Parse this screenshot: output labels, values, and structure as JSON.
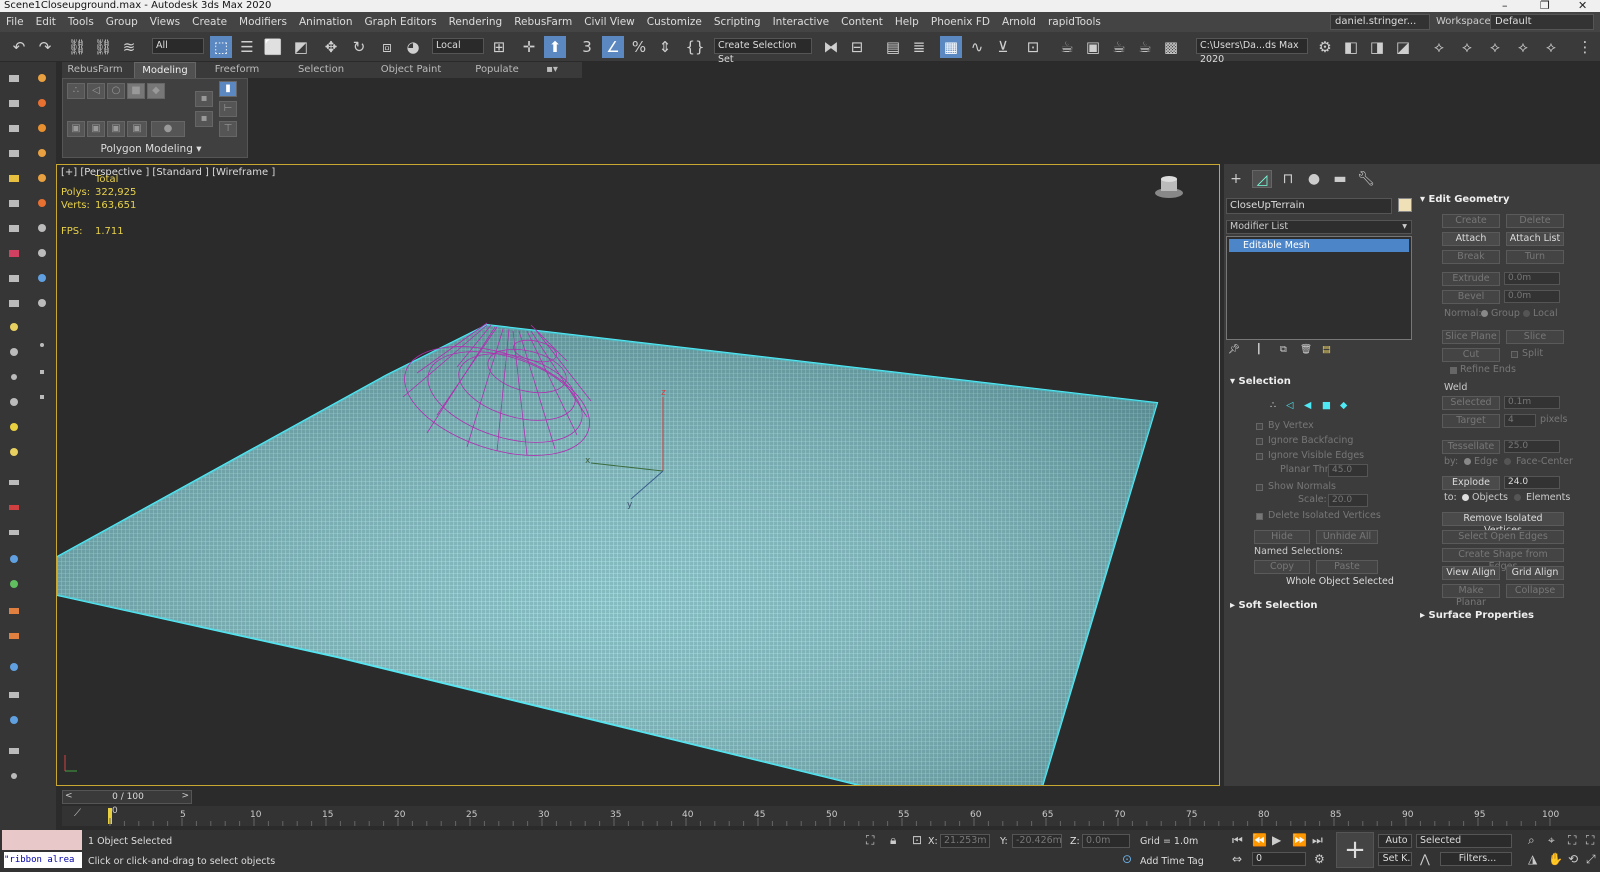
{
  "app": {
    "title": "Scene1Closeupground.max - Autodesk 3ds Max 2020",
    "win_min": "–",
    "win_max": "❐",
    "win_close": "✕"
  },
  "menu": [
    "File",
    "Edit",
    "Tools",
    "Group",
    "Views",
    "Create",
    "Modifiers",
    "Animation",
    "Graph Editors",
    "Rendering",
    "RebusFarm",
    "Civil View",
    "Customize",
    "Scripting",
    "Interactive",
    "Content",
    "Help",
    "Phoenix FD",
    "Arnold",
    "rapidTools"
  ],
  "user": "daniel.stringer...",
  "workspace": {
    "label": "Workspaces:",
    "value": "Default"
  },
  "toolbar": {
    "filter": "All",
    "coord": "Local",
    "selection_set": "Create Selection Set",
    "path": "C:\\Users\\Da...ds Max 2020"
  },
  "ribbon": {
    "tabs": [
      "RebusFarm",
      "Modeling",
      "Freeform",
      "Selection",
      "Object Paint",
      "Populate"
    ],
    "active_tab": "Modeling",
    "panel_label": "Polygon Modeling"
  },
  "viewport": {
    "label": "[+] [Perspective ] [Standard ] [Wireframe ]",
    "stats_total": "Total",
    "polys_label": "Polys:",
    "polys": "322,925",
    "verts_label": "Verts:",
    "verts": "163,651",
    "fps_label": "FPS:",
    "fps": "1.711",
    "axis_z": "z",
    "axis_x": "x",
    "axis_y": "y",
    "colors": {
      "terrain": "#8ee8ee",
      "terrain_edge": "#4fe9f5",
      "cone": "#b030b0"
    }
  },
  "command_panel": {
    "object_name": "CloseUpTerrain",
    "modifier_list": "Modifier List",
    "stack_item": "Editable Mesh",
    "selection": {
      "title": "Selection",
      "by_vertex": "By Vertex",
      "ignore_backfacing": "Ignore Backfacing",
      "ignore_visible_edges": "Ignore Visible Edges",
      "planar_thresh_label": "Planar Thresh:",
      "planar_thresh": "45.0",
      "show_normals": "Show Normals",
      "scale_label": "Scale:",
      "scale": "20.0",
      "delete_isolated": "Delete Isolated Vertices",
      "hide": "Hide",
      "unhide_all": "Unhide All",
      "named_selections": "Named Selections:",
      "copy": "Copy",
      "paste": "Paste",
      "status": "Whole Object Selected"
    },
    "soft_selection": "Soft Selection",
    "edit_geometry": {
      "title": "Edit Geometry",
      "create": "Create",
      "delete": "Delete",
      "attach": "Attach",
      "attach_list": "Attach List",
      "break": "Break",
      "turn": "Turn",
      "extrude": "Extrude",
      "extrude_val": "0.0m",
      "bevel": "Bevel",
      "bevel_val": "0.0m",
      "normal": "Normal:",
      "group": "Group",
      "local": "Local",
      "slice_plane": "Slice Plane",
      "slice": "Slice",
      "cut": "Cut",
      "split": "Split",
      "refine_ends": "Refine Ends",
      "weld": "Weld",
      "selected": "Selected",
      "selected_val": "0.1m",
      "target": "Target",
      "target_val": "4",
      "pixels": "pixels",
      "tessellate": "Tessellate",
      "tessellate_val": "25.0",
      "by": "by:",
      "edge": "Edge",
      "face_center": "Face-Center",
      "explode": "Explode",
      "explode_val": "24.0",
      "to": "to:",
      "objects": "Objects",
      "elements": "Elements",
      "remove_isolated": "Remove Isolated Vertices",
      "select_open_edges": "Select Open Edges",
      "create_shape": "Create Shape from Edges",
      "view_align": "View Align",
      "grid_align": "Grid Align",
      "make_planar": "Make Planar",
      "collapse": "Collapse"
    },
    "surface_properties": "Surface Properties"
  },
  "time": {
    "slider": "0 / 100",
    "ticks": [
      "0",
      "5",
      "10",
      "15",
      "20",
      "25",
      "30",
      "35",
      "40",
      "45",
      "50",
      "55",
      "60",
      "65",
      "70",
      "75",
      "80",
      "85",
      "90",
      "95",
      "100"
    ]
  },
  "status": {
    "maxscript": "\"ribbon alrea",
    "selected": "1 Object Selected",
    "prompt": "Click or click-and-drag to select objects",
    "x_label": "X:",
    "x": "21.253m",
    "y_label": "Y:",
    "y": "-20.426m",
    "z_label": "Z:",
    "z": "0.0m",
    "grid": "Grid = 1.0m",
    "add_time_tag": "Add Time Tag",
    "auto": "Auto",
    "selected_dd": "Selected",
    "set_k": "Set K.",
    "filters": "Filters...",
    "frame": "0"
  }
}
